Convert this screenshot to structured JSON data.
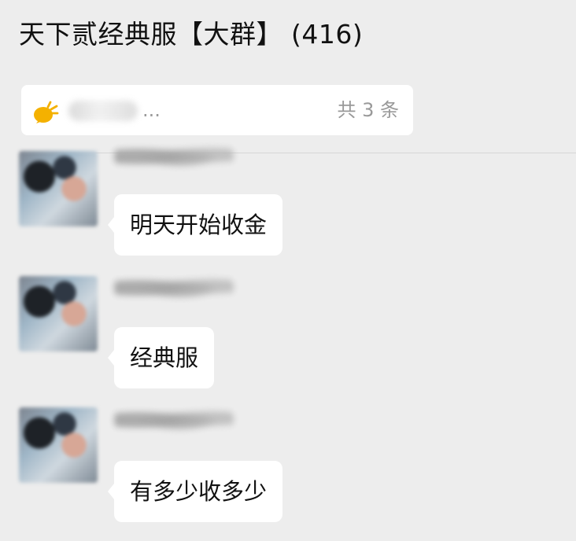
{
  "chat": {
    "title": "天下贰经典服【大群】 (416)"
  },
  "notice": {
    "icon": "announcement-icon",
    "snippet_tail": "...",
    "count": "共 3 条"
  },
  "messages": [
    {
      "text": "明天开始收金",
      "avatar": "avatar"
    },
    {
      "text": "经典服",
      "avatar": "avatar"
    },
    {
      "text": "有多少收多少",
      "avatar": "avatar"
    }
  ]
}
